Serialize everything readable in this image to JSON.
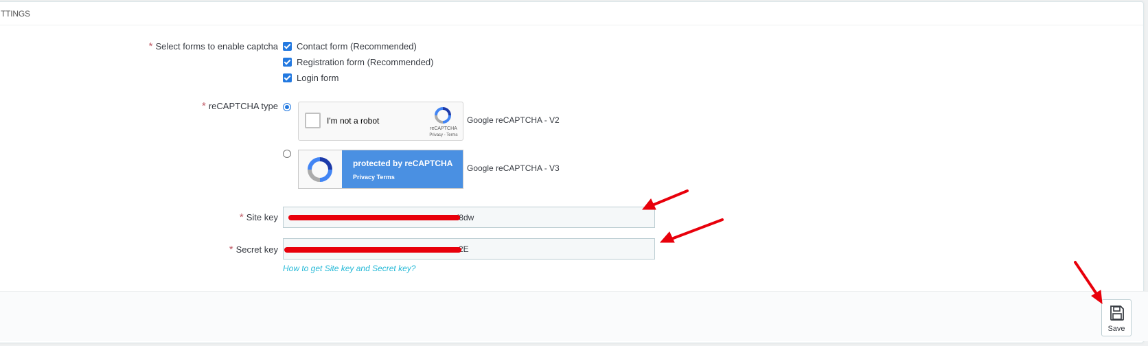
{
  "panel": {
    "heading": "TTINGS"
  },
  "forms": {
    "label": "Select forms to enable captcha",
    "options": [
      {
        "label": "Contact form (Recommended)",
        "checked": true
      },
      {
        "label": "Registration form (Recommended)",
        "checked": true
      },
      {
        "label": "Login form",
        "checked": true
      }
    ]
  },
  "recaptcha": {
    "label": "reCAPTCHA type",
    "v2": {
      "widget_text": "I'm not a robot",
      "brand": "reCAPTCHA",
      "links": "Privacy - Terms",
      "caption": "Google reCAPTCHA - V2",
      "selected": true
    },
    "v3": {
      "widget_title": "protected by reCAPTCHA",
      "widget_links": "Privacy  Terms",
      "caption": "Google reCAPTCHA - V3",
      "selected": false
    }
  },
  "site_key": {
    "label": "Site key",
    "visible_suffix": "f8dw"
  },
  "secret_key": {
    "label": "Secret key",
    "visible_suffix": "2E"
  },
  "help": {
    "link_text": "How to get Site key and Secret key?"
  },
  "footer": {
    "save_label": "Save",
    "save_icon": "floppy-disk-icon"
  },
  "colors": {
    "accent": "#2379e0",
    "required": "#c05c67",
    "link": "#25b9d7",
    "annotation": "#e8000b"
  }
}
